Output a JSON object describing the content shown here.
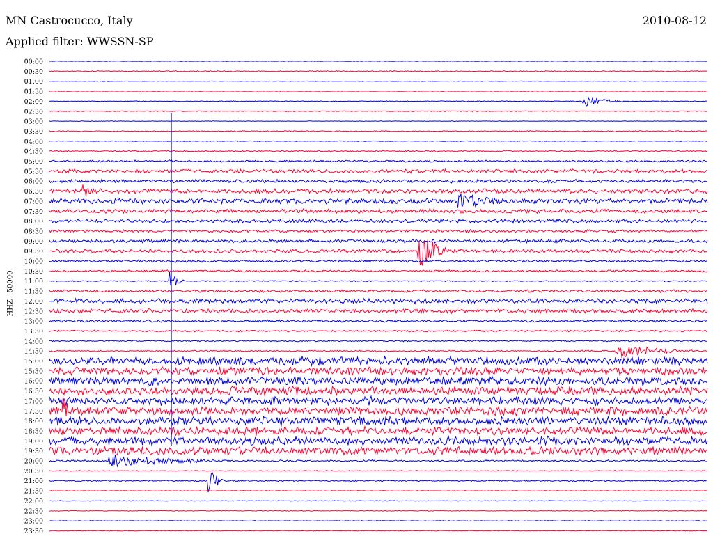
{
  "header": {
    "station": "MN Castrocucco, Italy",
    "date": "2010-08-12",
    "filter": "Applied filter: WWSSN-SP"
  },
  "axis": {
    "ylabel": "HHZ - 50000"
  },
  "colors": {
    "odd": "#0000e6",
    "even": "#ff0033"
  },
  "chart_data": {
    "type": "line",
    "title": "MN Castrocucco, Italy",
    "ylabel": "HHZ - 50000",
    "tick_labels": [
      "00:00",
      "00:30",
      "01:00",
      "01:30",
      "02:00",
      "02:30",
      "03:00",
      "03:30",
      "04:00",
      "04:30",
      "05:00",
      "05:30",
      "06:00",
      "06:30",
      "07:00",
      "07:30",
      "08:00",
      "08:30",
      "09:00",
      "09:30",
      "10:00",
      "10:30",
      "11:00",
      "11:30",
      "12:00",
      "12:30",
      "13:00",
      "13:30",
      "14:00",
      "14:30",
      "15:00",
      "15:30",
      "16:00",
      "16:30",
      "17:00",
      "17:30",
      "18:00",
      "18:30",
      "19:00",
      "19:30",
      "20:00",
      "20:30",
      "21:00",
      "21:30",
      "22:00",
      "22:30",
      "23:00",
      "23:30"
    ],
    "noise_level": [
      0.3,
      0.6,
      0.3,
      0.3,
      0.5,
      0.5,
      0.3,
      0.6,
      0.4,
      0.8,
      1.2,
      2.2,
      2.0,
      2.6,
      3.0,
      2.4,
      2.2,
      1.6,
      2.0,
      2.2,
      1.4,
      1.2,
      0.6,
      1.6,
      2.8,
      2.4,
      1.4,
      1.0,
      0.8,
      0.8,
      5.0,
      5.0,
      5.0,
      5.0,
      5.0,
      5.0,
      5.0,
      5.0,
      5.0,
      5.0,
      1.0,
      0.5,
      0.8,
      0.4,
      0.4,
      0.4,
      0.4,
      0.4
    ],
    "events": [
      {
        "row": 4,
        "x": 0.81,
        "amp": 8,
        "dur": 0.07
      },
      {
        "row": 13,
        "x": 0.05,
        "amp": 8,
        "dur": 0.03
      },
      {
        "row": 14,
        "x": 0.62,
        "amp": 10,
        "dur": 0.09
      },
      {
        "row": 19,
        "x": 0.56,
        "amp": 24,
        "dur": 0.06
      },
      {
        "row": 22,
        "x": 0.18,
        "amp": 14,
        "dur": 0.03
      },
      {
        "row": 29,
        "x": 0.86,
        "amp": 10,
        "dur": 0.14
      },
      {
        "row": 35,
        "x": 0.02,
        "amp": 18,
        "dur": 0.02
      },
      {
        "row": 40,
        "x": 0.09,
        "amp": 8,
        "dur": 0.2
      },
      {
        "row": 42,
        "x": 0.24,
        "amp": 18,
        "dur": 0.03
      }
    ]
  }
}
